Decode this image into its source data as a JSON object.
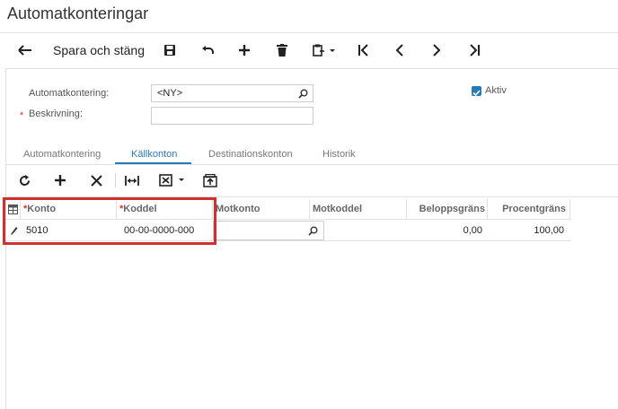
{
  "page": {
    "title": "Automatkonteringar"
  },
  "toolbar": {
    "back_icon": "arrow-left-icon",
    "save_close_label": "Spara och stäng",
    "icons": [
      "save-icon",
      "undo-icon",
      "plus-icon",
      "trash-icon",
      "clipboard-dropdown-icon",
      "first-icon",
      "prev-icon",
      "next-icon",
      "last-icon"
    ]
  },
  "form": {
    "automatkontering_label": "Automatkontering:",
    "automatkontering_value": "<NY>",
    "beskrivning_label": "Beskrivning:",
    "beskrivning_value": "",
    "aktiv_label": "Aktiv",
    "aktiv_checked": true,
    "required_marker": "*"
  },
  "tabs": [
    {
      "label": "Automatkontering",
      "active": false
    },
    {
      "label": "Källkonton",
      "active": true
    },
    {
      "label": "Destinationskonton",
      "active": false
    },
    {
      "label": "Historik",
      "active": false
    }
  ],
  "grid": {
    "toolbar_icons": [
      "refresh-icon",
      "add-row-icon",
      "delete-row-icon",
      "fit-columns-icon",
      "export-excel-icon",
      "upload-icon"
    ],
    "columns": [
      {
        "label": "Konto",
        "required": true
      },
      {
        "label": "Koddel",
        "required": true
      },
      {
        "label": "Motkonto",
        "required": false
      },
      {
        "label": "Motkoddel",
        "required": false
      },
      {
        "label": "Beloppsgräns",
        "required": false
      },
      {
        "label": "Procentgräns",
        "required": false
      }
    ],
    "rows": [
      {
        "konto": "5010",
        "koddel": "00-00-0000-000",
        "motkonto": "",
        "motkoddel": "",
        "beloppsgrans": "0,00",
        "procentgrans": "100,00"
      }
    ]
  },
  "colors": {
    "accent": "#2a7ab8",
    "highlight": "#d32f2f",
    "required": "#e0301e"
  }
}
